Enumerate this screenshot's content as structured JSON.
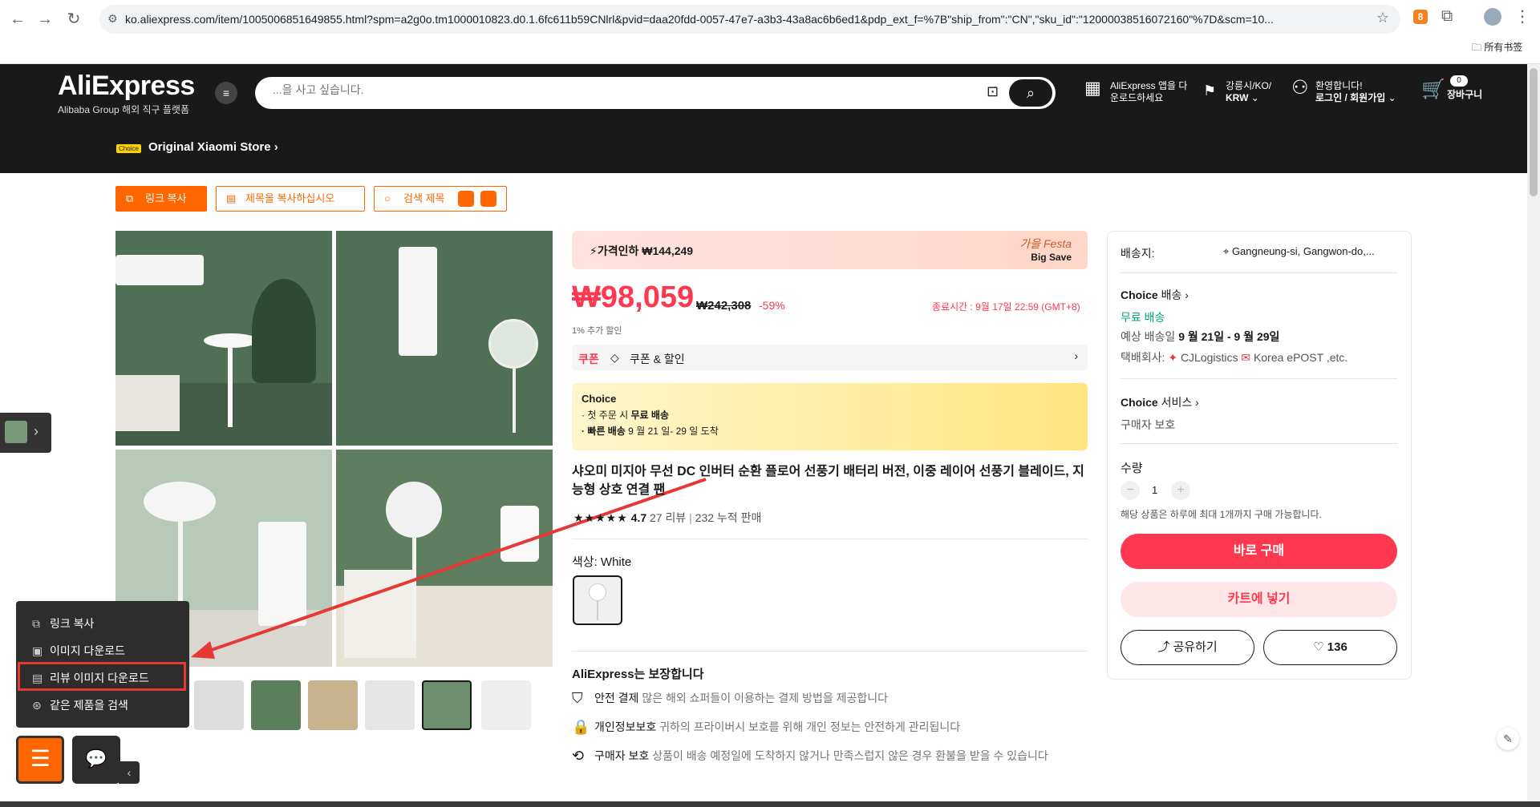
{
  "browser": {
    "url": "ko.aliexpress.com/item/1005006851649855.html?spm=a2g0o.tm1000010823.d0.1.6fc611b59CNlrl&pvid=daa20fdd-0057-47e7-a3b3-43a8ac6b6ed1&pdp_ext_f=%7B\"ship_from\":\"CN\",\"sku_id\":\"12000038516072160\"%7D&scm=10...",
    "extension_badge": "8",
    "bookmarks_label": "所有书签"
  },
  "header": {
    "logo": "AliExpress",
    "logo_sub": "Alibaba Group 해외 직구 플랫폼",
    "search_placeholder": "...을 사고 싶습니다.",
    "app_promo_line1": "AliExpress 앱을 다",
    "app_promo_line2": "운로드하세요",
    "region_line1": "강릉시/KO/",
    "region_line2": "KRW",
    "welcome": "환영합니다!",
    "login": "로그인 / 회원가입",
    "cart_count": "0",
    "cart_label": "장바구니",
    "store_badge": "Choice",
    "store_name": "Original Xiaomi Store"
  },
  "toolbar": {
    "copy_link": "링크 복사",
    "copy_title": "제목을 복사하십시오",
    "search_title": "검색 제목"
  },
  "price_section": {
    "banner_text": "가격인하 ₩144,249",
    "festa_line1": "가을 Festa",
    "festa_line2": "Big Save",
    "price": "₩98,059",
    "original_price": "₩242,308",
    "discount": "-59%",
    "end_time": "종료시간 : 9월 17일 22:59 (GMT+8)",
    "extra_discount": "1% 추가 할인",
    "coupon_label": "쿠폰",
    "coupon_text": "쿠폰 & 할인"
  },
  "choice_box": {
    "title": "Choice",
    "line1_prefix": "· 첫 주문 시 ",
    "line1_bold": "무료 배송",
    "line2_bold": "· 빠른 배송",
    "line2_rest": " 9 월 21 일- 29 일 도착"
  },
  "product": {
    "title": "샤오미 미지아 무선 DC 인버터 순환 플로어 선풍기 배터리 버전, 이중 레이어 선풍기 블레이드, 지능형 상호 연결 팬",
    "stars": "★★★★★",
    "rating": "4.7",
    "reviews": "27 리뷰",
    "sold": "232 누적 판매",
    "color_label": "색상: White"
  },
  "guarantee": {
    "title": "AliExpress는 보장합니다",
    "items": [
      {
        "icon": "shield-icon",
        "title": "안전 결제",
        "desc": "많은 해외 쇼퍼들이 이용하는 결제 방법을 제공합니다"
      },
      {
        "icon": "lock-icon",
        "title": "개인정보보호",
        "desc": "귀하의 프라이버시 보호를 위해 개인 정보는 안전하게 관리됩니다"
      },
      {
        "icon": "return-icon",
        "title": "구매자 보호",
        "desc": "상품이 배송 예정일에 도착하지 않거나 만족스럽지 않은 경우 환불을 받을 수 있습니다"
      }
    ]
  },
  "side_panel": {
    "ship_to_label": "배송지:",
    "ship_to_value": "Gangneung-si, Gangwon-do,...",
    "choice_shipping_brand": "Choice",
    "choice_shipping_label": "배송",
    "free_shipping": "무료 배송",
    "delivery_label": "예상 배송일",
    "delivery_dates": "9 월 21일 - 9 월 29일",
    "carrier_label": "택배회사:",
    "carrier1": "CJLogistics",
    "carrier2": "Korea ePOST ,etc.",
    "choice_service_brand": "Choice",
    "choice_service_label": "서비스",
    "buyer_protection": "구매자 보호",
    "qty_label": "수량",
    "qty_value": "1",
    "qty_limit": "해당 상품은 하루에 최대 1개까지 구매 가능합니다.",
    "buy_now": "바로 구매",
    "add_cart": "카트에 넣기",
    "share": "공유하기",
    "wishlist_count": "136"
  },
  "popup_menu": {
    "items": [
      "링크 복사",
      "이미지 다운로드",
      "리뷰 이미지 다운로드",
      "같은 제품을 검색"
    ]
  },
  "colors": {
    "accent_red": "#fd384f",
    "accent_orange": "#ff6600",
    "header_bg": "#191919",
    "annotation_red": "#e53935"
  }
}
